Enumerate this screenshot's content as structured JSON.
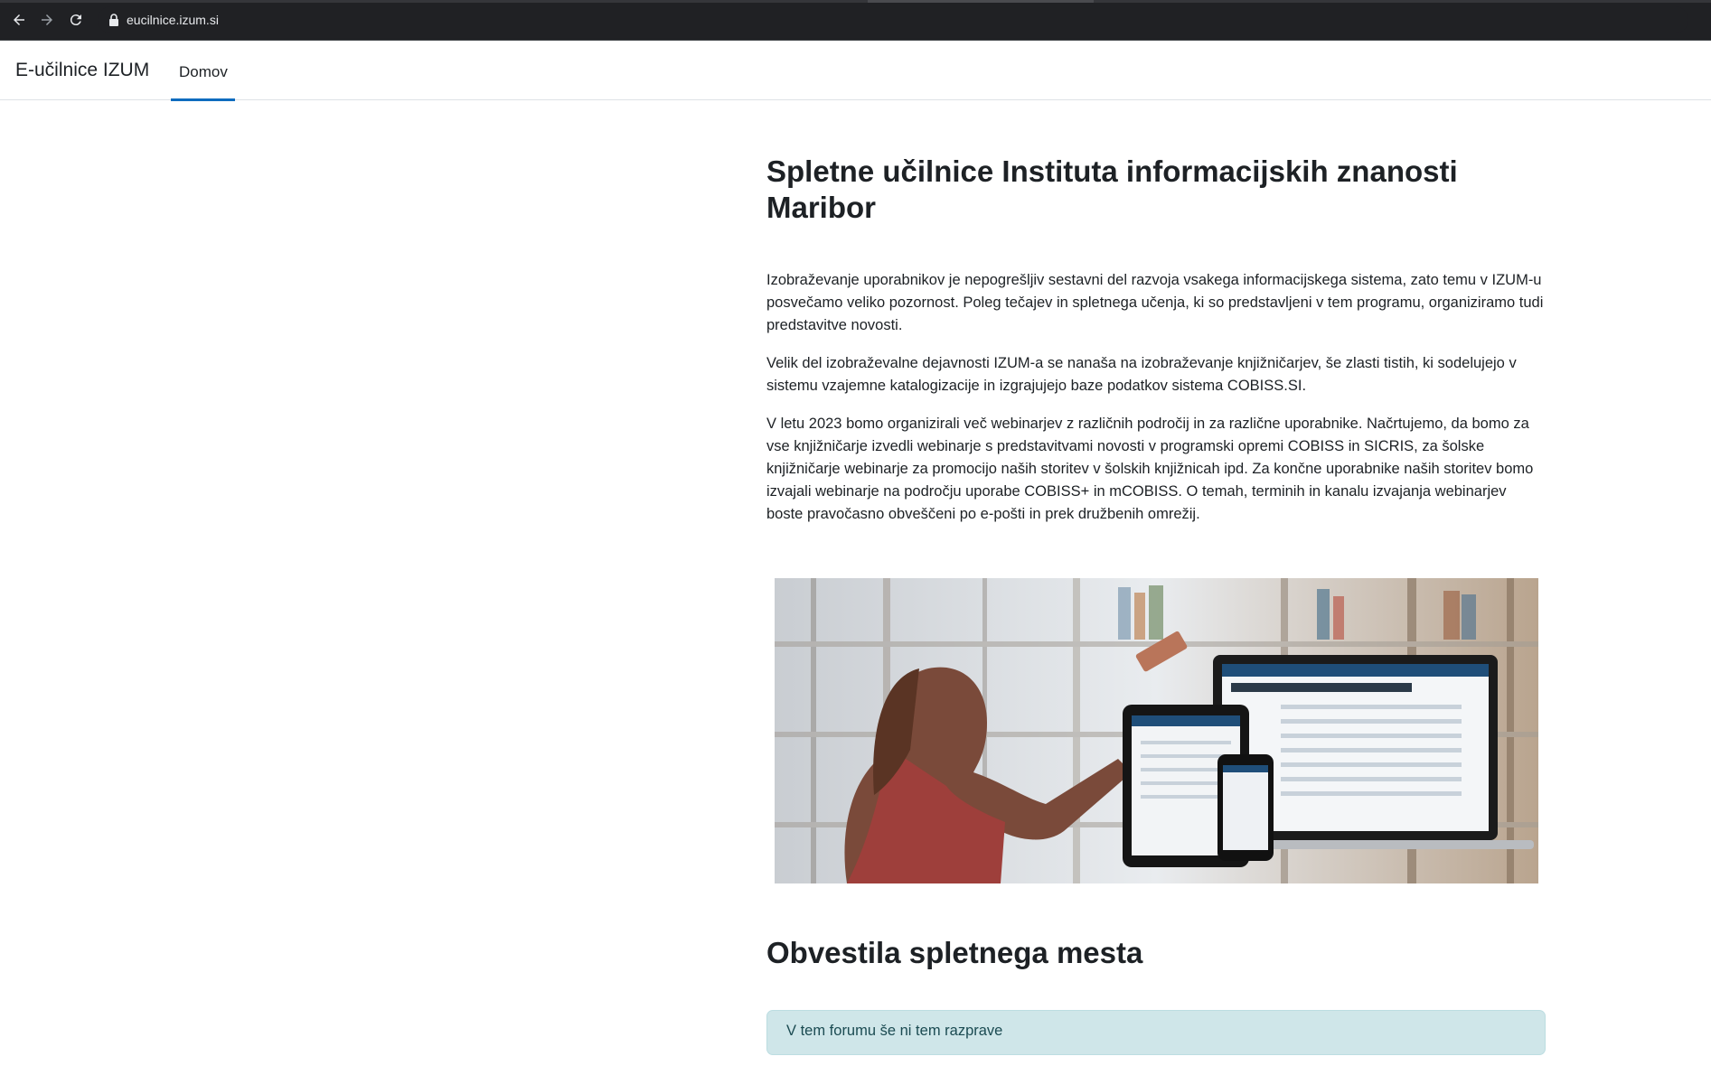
{
  "browser": {
    "url": "eucilnice.izum.si"
  },
  "navbar": {
    "brand": "E-učilnice IZUM",
    "items": [
      {
        "label": "Domov",
        "active": true
      }
    ]
  },
  "main": {
    "title": "Spletne učilnice Instituta informacijskih znanosti Maribor",
    "paragraphs": [
      "Izobraževanje uporabnikov je nepogrešljiv sestavni del razvoja vsakega informacijskega sistema, zato temu v IZUM-u posvečamo veliko pozornost. Poleg tečajev in spletnega učenja, ki so predstavljeni v tem programu, organiziramo tudi predstavitve novosti.",
      "Velik del izobraževalne dejavnosti IZUM-a se nanaša na izobraževanje knjižničarjev, še zlasti tistih, ki sodelujejo v sistemu vzajemne katalogizacije in izgrajujejo baze podatkov sistema COBISS.SI.",
      "V letu 2023 bomo organizirali več webinarjev z različnih področij in za različne uporabnike. Načrtujemo, da bomo za vse knjižničarje izvedli webinarje s predstavitvami novosti v programski opremi COBISS in SICRIS, za šolske knjižničarje webinarje za promocijo naših storitev v šolskih knjižnicah ipd. Za končne uporabnike naših storitev bomo izvajali webinarje na področju uporabe COBISS+ in mCOBISS. O temah, terminih in kanalu izvajanja webinarjev boste pravočasno obveščeni po e-pošti in prek družbenih omrežij."
    ],
    "hero_image": "woman-at-library-shelves-with-devices"
  },
  "news": {
    "title": "Obvestila spletnega mesta",
    "empty_message": "V tem forumu še ni tem razprave"
  },
  "colors": {
    "accent": "#0f6cbf",
    "alert_bg": "#cfe6e9",
    "alert_text": "#1b4b52"
  }
}
